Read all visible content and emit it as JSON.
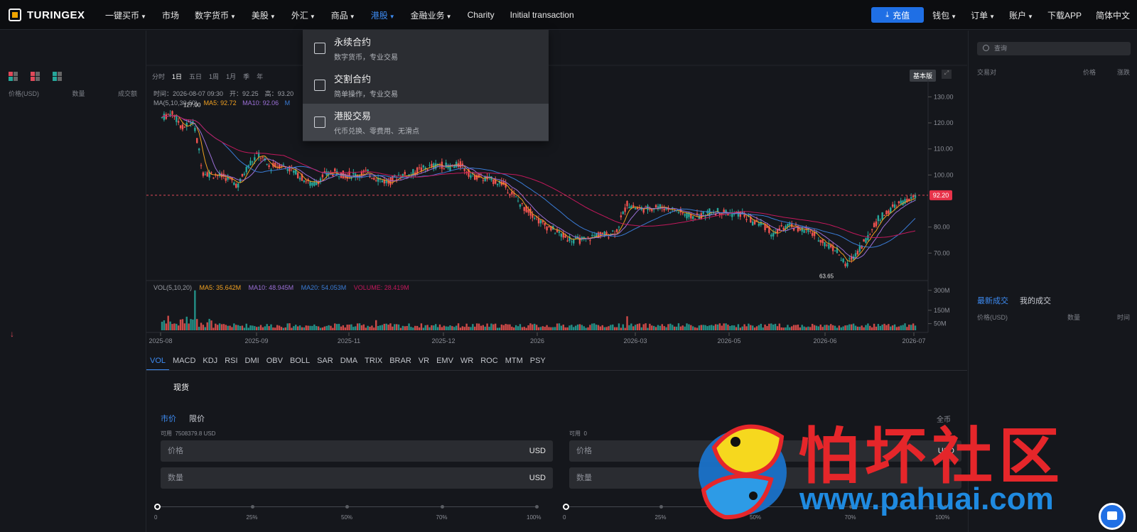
{
  "brand": {
    "name": "TURINGEX"
  },
  "nav": {
    "items": [
      {
        "label": "一键买币",
        "caret": true
      },
      {
        "label": "市场",
        "caret": false
      },
      {
        "label": "数字货币",
        "caret": true
      },
      {
        "label": "美股",
        "caret": true
      },
      {
        "label": "外汇",
        "caret": true
      },
      {
        "label": "商品",
        "caret": true
      },
      {
        "label": "港股",
        "caret": true,
        "active": true
      },
      {
        "label": "金融业务",
        "caret": true
      },
      {
        "label": "Charity",
        "caret": false
      },
      {
        "label": "Initial transaction",
        "caret": false
      }
    ],
    "deposit": "充值",
    "right": [
      {
        "label": "钱包",
        "caret": true
      },
      {
        "label": "订单",
        "caret": true
      },
      {
        "label": "账户",
        "caret": true
      },
      {
        "label": "下载APP",
        "caret": false
      },
      {
        "label": "简体中文",
        "caret": false
      }
    ]
  },
  "dropdown": [
    {
      "title": "永续合约",
      "desc": "数字货币，专业交易",
      "icon": "trend-chart-icon"
    },
    {
      "title": "交割合约",
      "desc": "简单操作，专业交易",
      "icon": "document-clock-icon"
    },
    {
      "title": "港股交易",
      "desc": "代币兑换、零费用、无滑点",
      "icon": "exchange-icon",
      "highlighted": true
    }
  ],
  "orderbook": {
    "headers": [
      "价格(USD)",
      "数量",
      "成交额"
    ]
  },
  "chart": {
    "timeframes": [
      "分时",
      "1日",
      "五日",
      "1周",
      "1月",
      "季",
      "年"
    ],
    "active_timeframe": "1日",
    "basic_label": "基本版",
    "ohlc_text": "时间：2026-08-07 09:30　开：92.25　高：93.20",
    "ma_params": "MA(5,10,30,60)",
    "ma5": "MA5: 92.72",
    "ma10": "MA10: 92.06",
    "ma_more": "M",
    "vol_params": "VOL(5,10,20)",
    "vol_ma5": "MA5: 35.642M",
    "vol_ma10": "MA10: 48.945M",
    "vol_ma20": "MA20: 54.053M",
    "vol_volume": "VOLUME: 28.419M",
    "price_ticks": [
      "130.00",
      "120.00",
      "110.00",
      "100.00",
      "80.00",
      "70.00"
    ],
    "volume_ticks": [
      "300M",
      "150M",
      "50M"
    ],
    "x_ticks": [
      "2025-08",
      "2025-09",
      "2025-11",
      "2025-12",
      "2026",
      "2026-03",
      "2026-05",
      "2026-06",
      "2026-07"
    ],
    "current_price": "92.20",
    "high_label": "127.00",
    "low_label": "63.65",
    "colors": {
      "up": "#26a69a",
      "down": "#ef5350",
      "ma5": "#f0a020",
      "ma10": "#9b6fd6",
      "ma30": "#3a7bd5",
      "ma60": "#c2185b"
    }
  },
  "chart_data": {
    "type": "candlestick",
    "x_range": [
      "2025-08",
      "2026-08-07"
    ],
    "ylim": [
      60,
      135
    ],
    "close_path": [
      [
        0,
        122
      ],
      [
        5,
        124
      ],
      [
        10,
        118
      ],
      [
        15,
        121
      ],
      [
        20,
        101
      ],
      [
        26,
        100
      ],
      [
        31,
        99
      ],
      [
        37,
        96
      ],
      [
        42,
        104
      ],
      [
        47,
        108
      ],
      [
        52,
        103
      ],
      [
        58,
        104
      ],
      [
        63,
        102
      ],
      [
        68,
        99
      ],
      [
        73,
        96
      ],
      [
        79,
        100
      ],
      [
        84,
        101
      ],
      [
        89,
        100
      ],
      [
        94,
        100
      ],
      [
        99,
        101
      ],
      [
        104,
        99
      ],
      [
        110,
        97
      ],
      [
        115,
        100
      ],
      [
        120,
        100
      ],
      [
        125,
        102
      ],
      [
        130,
        103
      ],
      [
        135,
        104
      ],
      [
        140,
        103
      ],
      [
        145,
        104
      ],
      [
        150,
        100
      ],
      [
        155,
        99
      ],
      [
        160,
        98
      ],
      [
        165,
        97
      ],
      [
        170,
        93
      ],
      [
        175,
        88
      ],
      [
        180,
        85
      ],
      [
        185,
        81
      ],
      [
        190,
        79
      ],
      [
        196,
        76
      ],
      [
        201,
        75
      ],
      [
        206,
        75
      ],
      [
        211,
        77
      ],
      [
        216,
        77
      ],
      [
        221,
        79
      ],
      [
        226,
        89
      ],
      [
        231,
        87
      ],
      [
        236,
        87
      ],
      [
        241,
        88
      ],
      [
        246,
        87
      ],
      [
        251,
        86
      ],
      [
        256,
        84
      ],
      [
        261,
        84
      ],
      [
        267,
        86
      ],
      [
        272,
        86
      ],
      [
        277,
        85
      ],
      [
        282,
        85
      ],
      [
        287,
        82
      ],
      [
        292,
        81
      ],
      [
        297,
        77
      ],
      [
        302,
        80
      ],
      [
        307,
        80
      ],
      [
        312,
        79
      ],
      [
        317,
        77
      ],
      [
        322,
        74
      ],
      [
        328,
        71
      ],
      [
        332,
        65
      ],
      [
        337,
        70
      ],
      [
        342,
        75
      ],
      [
        348,
        83
      ],
      [
        353,
        86
      ],
      [
        358,
        89
      ],
      [
        363,
        90
      ],
      [
        366,
        92
      ]
    ],
    "volume_note": "daily volume bars, peak ~300M near 2025-08"
  },
  "indicators": {
    "tabs": [
      "VOL",
      "MACD",
      "KDJ",
      "RSI",
      "DMI",
      "OBV",
      "BOLL",
      "SAR",
      "DMA",
      "TRIX",
      "BRAR",
      "VR",
      "EMV",
      "WR",
      "ROC",
      "MTM",
      "PSY"
    ],
    "active": "VOL"
  },
  "spot_title": "现货",
  "order": {
    "tabs": [
      "市价",
      "限价"
    ],
    "active": "市价",
    "buy": {
      "avail_label": "可用",
      "avail_value": "7508379.8 USD",
      "price_ph": "价格",
      "qty_ph": "数量",
      "price_unit": "USD",
      "qty_unit": "USD"
    },
    "sell": {
      "avail_label": "可用",
      "avail_value": "0",
      "price_ph": "价格",
      "qty_ph": "数量",
      "price_unit": "USD",
      "corner": "全币"
    },
    "percent_labels": [
      "0",
      "25%",
      "50%",
      "70%",
      "100%"
    ],
    "slider_level": 0
  },
  "market": {
    "search_ph": "查询",
    "headers": [
      "交易对",
      "价格",
      "涨跌"
    ],
    "trade_tabs": [
      "最新成交",
      "我的成交"
    ],
    "active_trade_tab": "最新成交",
    "trade_headers": [
      "价格(USD)",
      "数量",
      "时间"
    ]
  },
  "watermark": {
    "text": "怕坏社区",
    "url": "www.pahuai.com"
  }
}
